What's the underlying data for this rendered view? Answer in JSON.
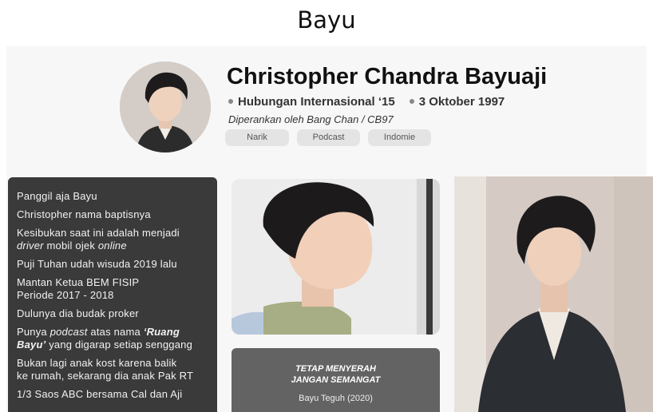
{
  "header": {
    "title": "Bayu"
  },
  "profile": {
    "name": "Christopher Chandra Bayuaji",
    "major": "Hubungan Internasional ‘15",
    "birthdate": "3 Oktober 1997",
    "cast": "Diperankan oleh Bang Chan / CB97",
    "tags": [
      "Narik",
      "Podcast",
      "Indomie"
    ]
  },
  "facts": {
    "f0": "Panggil aja Bayu",
    "f1": "Christopher nama baptisnya",
    "f2a": "Kesibukan saat ini adalah menjadi",
    "f2b": "driver",
    "f2c": " mobil ojek ",
    "f2d": "online",
    "f3": "Puji Tuhan udah wisuda 2019 lalu",
    "f4a": "Mantan Ketua BEM FISIP",
    "f4b": "Periode 2017 - 2018",
    "f5": "Dulunya dia budak proker",
    "f6a": "Punya ",
    "f6b": "podcast",
    "f6c": " atas nama ",
    "f6d": "‘Ruang Bayu’",
    "f6e": " yang digarap setiap senggang",
    "f7a": "Bukan lagi anak kost karena balik",
    "f7b": "ke rumah, sekarang dia anak Pak RT",
    "f8": "1/3 Saos ABC bersama Cal dan Aji"
  },
  "quote": {
    "line1": "TETAP MENYERAH",
    "line2": "JANGAN SEMANGAT",
    "author": "Bayu Teguh (2020)"
  },
  "colors": {
    "dark_panel": "#3a3a3a",
    "quote_panel": "#636363",
    "tag_bg": "#e4e4e4"
  }
}
